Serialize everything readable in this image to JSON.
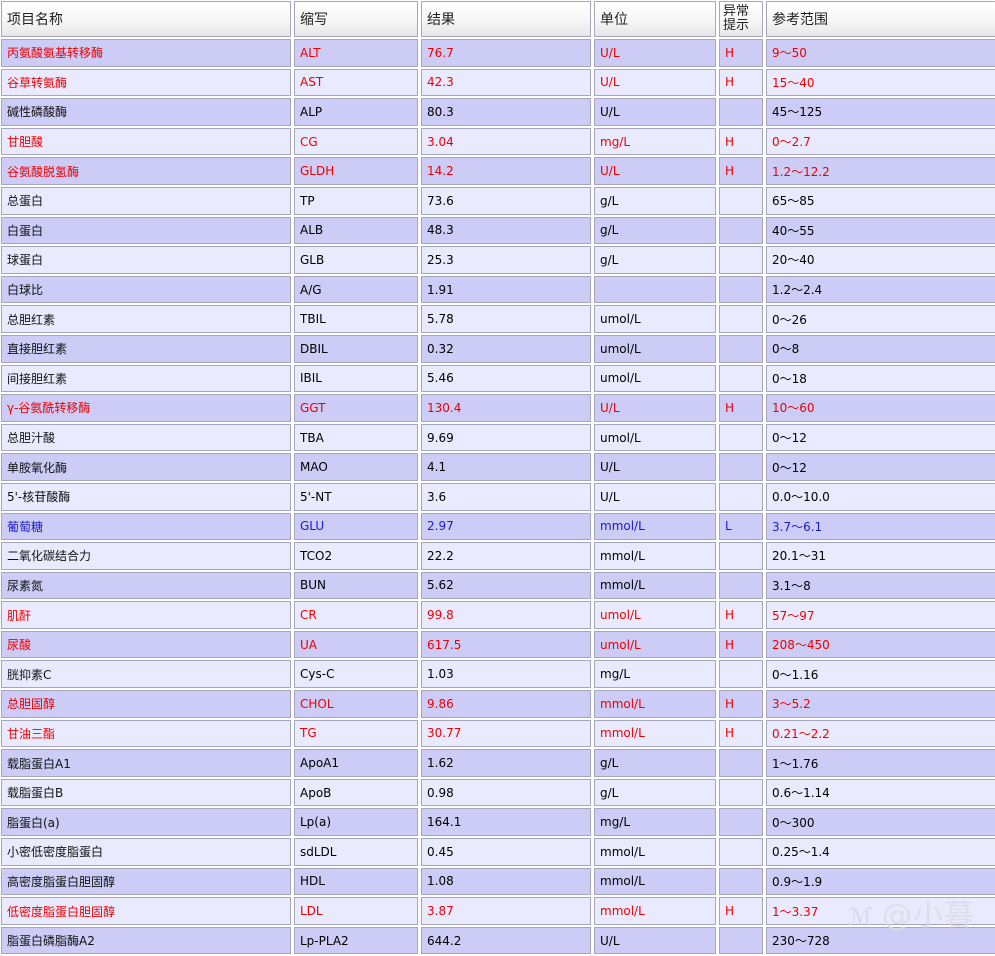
{
  "headers": {
    "name": "项目名称",
    "abbr": "缩写",
    "result": "结果",
    "unit": "单位",
    "flag": "异常\n提示",
    "range": "参考范围"
  },
  "colors": {
    "high": "#ee0000",
    "low": "#1a1acc",
    "normal": "#111111",
    "row_odd": "#ccccf6",
    "row_even": "#eaeaff"
  },
  "rows": [
    {
      "name": "丙氨酸氨基转移酶",
      "abbr": "ALT",
      "result": "76.7",
      "unit": "U/L",
      "flag": "H",
      "range": "9～50"
    },
    {
      "name": "谷草转氨酶",
      "abbr": "AST",
      "result": "42.3",
      "unit": "U/L",
      "flag": "H",
      "range": "15～40"
    },
    {
      "name": "碱性磷酸酶",
      "abbr": "ALP",
      "result": "80.3",
      "unit": "U/L",
      "flag": "",
      "range": "45～125"
    },
    {
      "name": "甘胆酸",
      "abbr": "CG",
      "result": "3.04",
      "unit": "mg/L",
      "flag": "H",
      "range": "0～2.7"
    },
    {
      "name": "谷氨酸脱氢酶",
      "abbr": "GLDH",
      "result": "14.2",
      "unit": "U/L",
      "flag": "H",
      "range": "1.2～12.2"
    },
    {
      "name": "总蛋白",
      "abbr": "TP",
      "result": "73.6",
      "unit": "g/L",
      "flag": "",
      "range": "65～85"
    },
    {
      "name": "白蛋白",
      "abbr": "ALB",
      "result": "48.3",
      "unit": "g/L",
      "flag": "",
      "range": "40～55"
    },
    {
      "name": "球蛋白",
      "abbr": "GLB",
      "result": "25.3",
      "unit": "g/L",
      "flag": "",
      "range": "20～40"
    },
    {
      "name": "白球比",
      "abbr": "A/G",
      "result": "1.91",
      "unit": "",
      "flag": "",
      "range": "1.2～2.4"
    },
    {
      "name": "总胆红素",
      "abbr": "TBIL",
      "result": "5.78",
      "unit": "umol/L",
      "flag": "",
      "range": "0～26"
    },
    {
      "name": "直接胆红素",
      "abbr": "DBIL",
      "result": "0.32",
      "unit": "umol/L",
      "flag": "",
      "range": "0～8"
    },
    {
      "name": "间接胆红素",
      "abbr": "IBIL",
      "result": "5.46",
      "unit": "umol/L",
      "flag": "",
      "range": "0～18"
    },
    {
      "name": "γ-谷氨酰转移酶",
      "abbr": "GGT",
      "result": "130.4",
      "unit": "U/L",
      "flag": "H",
      "range": "10～60"
    },
    {
      "name": "总胆汁酸",
      "abbr": "TBA",
      "result": "9.69",
      "unit": "umol/L",
      "flag": "",
      "range": "0～12"
    },
    {
      "name": "单胺氧化酶",
      "abbr": "MAO",
      "result": "4.1",
      "unit": "U/L",
      "flag": "",
      "range": "0～12"
    },
    {
      "name": "5'-核苷酸酶",
      "abbr": "5'-NT",
      "result": "3.6",
      "unit": "U/L",
      "flag": "",
      "range": "0.0～10.0"
    },
    {
      "name": "葡萄糖",
      "abbr": "GLU",
      "result": "2.97",
      "unit": "mmol/L",
      "flag": "L",
      "range": "3.7～6.1"
    },
    {
      "name": "二氧化碳结合力",
      "abbr": "TCO2",
      "result": "22.2",
      "unit": "mmol/L",
      "flag": "",
      "range": "20.1～31"
    },
    {
      "name": "尿素氮",
      "abbr": "BUN",
      "result": "5.62",
      "unit": "mmol/L",
      "flag": "",
      "range": "3.1～8"
    },
    {
      "name": "肌酐",
      "abbr": "CR",
      "result": "99.8",
      "unit": "umol/L",
      "flag": "H",
      "range": "57～97"
    },
    {
      "name": "尿酸",
      "abbr": "UA",
      "result": "617.5",
      "unit": "umol/L",
      "flag": "H",
      "range": "208～450"
    },
    {
      "name": "胱抑素C",
      "abbr": "Cys-C",
      "result": "1.03",
      "unit": "mg/L",
      "flag": "",
      "range": "0～1.16"
    },
    {
      "name": "总胆固醇",
      "abbr": "CHOL",
      "result": "9.86",
      "unit": "mmol/L",
      "flag": "H",
      "range": "3～5.2"
    },
    {
      "name": "甘油三酯",
      "abbr": "TG",
      "result": "30.77",
      "unit": "mmol/L",
      "flag": "H",
      "range": "0.21～2.2"
    },
    {
      "name": "载脂蛋白A1",
      "abbr": "ApoA1",
      "result": "1.62",
      "unit": "g/L",
      "flag": "",
      "range": "1～1.76"
    },
    {
      "name": "载脂蛋白B",
      "abbr": "ApoB",
      "result": "0.98",
      "unit": "g/L",
      "flag": "",
      "range": "0.6～1.14"
    },
    {
      "name": "脂蛋白(a)",
      "abbr": "Lp(a)",
      "result": "164.1",
      "unit": "mg/L",
      "flag": "",
      "range": "0～300"
    },
    {
      "name": "小密低密度脂蛋白",
      "abbr": "sdLDL",
      "result": "0.45",
      "unit": "mmol/L",
      "flag": "",
      "range": "0.25～1.4"
    },
    {
      "name": "高密度脂蛋白胆固醇",
      "abbr": "HDL",
      "result": "1.08",
      "unit": "mmol/L",
      "flag": "",
      "range": "0.9～1.9"
    },
    {
      "name": "低密度脂蛋白胆固醇",
      "abbr": "LDL",
      "result": "3.87",
      "unit": "mmol/L",
      "flag": "H",
      "range": "1～3.37"
    },
    {
      "name": "脂蛋白磷脂酶A2",
      "abbr": "Lp-PLA2",
      "result": "644.2",
      "unit": "U/L",
      "flag": "",
      "range": "230～728"
    }
  ],
  "watermark": {
    "text": "@小暮"
  }
}
